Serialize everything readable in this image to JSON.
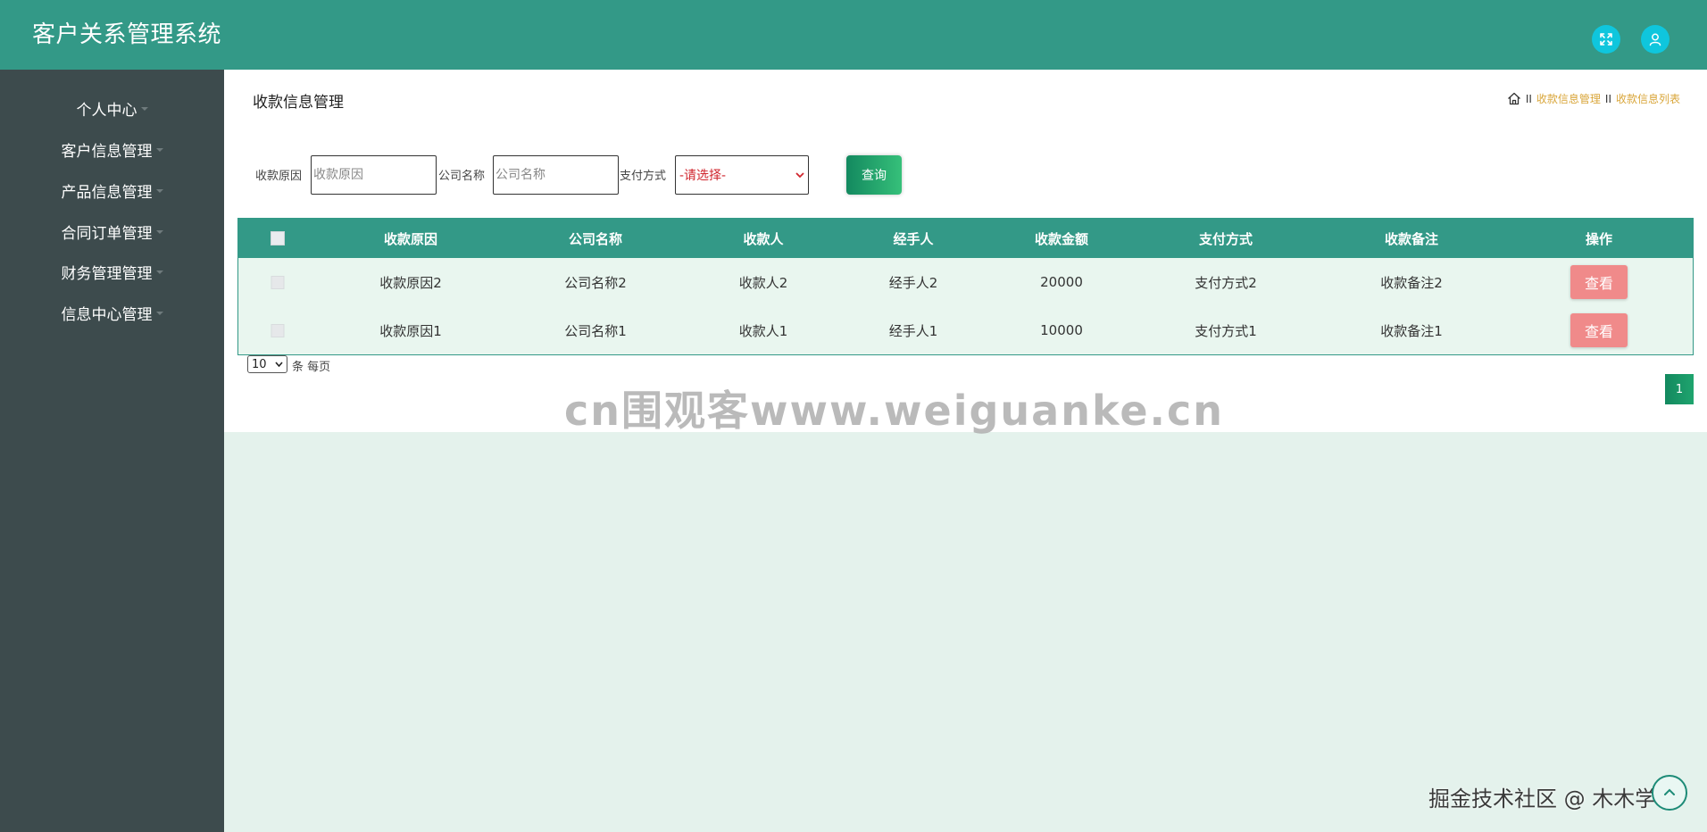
{
  "header": {
    "title": "客户关系管理系统",
    "fullscreen_icon": "fullscreen-icon",
    "user_icon": "user-icon"
  },
  "sidebar": {
    "items": [
      {
        "label": "个人中心"
      },
      {
        "label": "客户信息管理"
      },
      {
        "label": "产品信息管理"
      },
      {
        "label": "合同订单管理"
      },
      {
        "label": "财务管理管理"
      },
      {
        "label": "信息中心管理"
      }
    ]
  },
  "page": {
    "title": "收款信息管理",
    "breadcrumb": {
      "home_icon": "home-icon",
      "separator": "II",
      "items": [
        "收款信息管理",
        "收款信息列表"
      ]
    }
  },
  "search": {
    "reason_label": "收款原因",
    "reason_placeholder": "收款原因",
    "company_label": "公司名称",
    "company_placeholder": "公司名称",
    "pay_label": "支付方式",
    "pay_selected": "-请选择-",
    "query_label": "查询"
  },
  "table": {
    "columns": [
      "收款原因",
      "公司名称",
      "收款人",
      "经手人",
      "收款金额",
      "支付方式",
      "收款备注",
      "操作"
    ],
    "rows": [
      {
        "reason": "收款原因2",
        "company": "公司名称2",
        "payee": "收款人2",
        "handler": "经手人2",
        "amount": "20000",
        "method": "支付方式2",
        "note": "收款备注2",
        "action": "查看"
      },
      {
        "reason": "收款原因1",
        "company": "公司名称1",
        "payee": "收款人1",
        "handler": "经手人1",
        "amount": "10000",
        "method": "支付方式1",
        "note": "收款备注1",
        "action": "查看"
      }
    ]
  },
  "pager": {
    "page_size": "10",
    "page_size_label": "条 每页",
    "current_page": "1"
  },
  "watermark": {
    "site": "cn围观客www.weiguanke.cn",
    "credit": "掘金技术社区 @ 木木学长"
  },
  "colors": {
    "header": "#339987",
    "sidebar": "#3d4b4d",
    "view_button": "#f08a8a",
    "breadcrumb": "#d9a63a"
  }
}
